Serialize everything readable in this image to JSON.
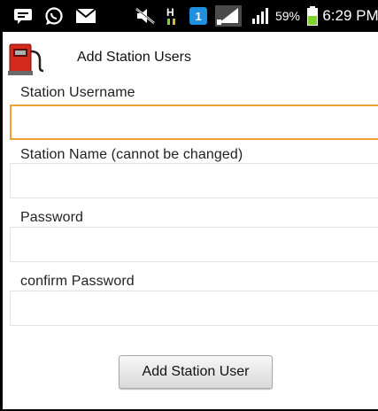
{
  "status_bar": {
    "icons": [
      "messenger-icon",
      "whatsapp-icon",
      "email-icon",
      "mute-icon",
      "data-transfer-icon",
      "notification-icon",
      "signal-icon",
      "signal-icon"
    ],
    "signal_indicator": "H",
    "notification_badge": "1",
    "battery_percent": "59%",
    "time": "6:29 PM"
  },
  "header": {
    "title": "Add Station Users",
    "app_icon": "fuel-pump-icon"
  },
  "form": {
    "username": {
      "label": "Station Username",
      "value": "",
      "placeholder": ""
    },
    "station_name": {
      "label": "Station Name (cannot be changed)",
      "value": "",
      "placeholder": ""
    },
    "password": {
      "label": "Password",
      "value": "",
      "placeholder": ""
    },
    "confirm_password": {
      "label": "confirm Password",
      "value": "",
      "placeholder": ""
    },
    "submit_label": "Add Station User"
  },
  "colors": {
    "focus_border": "#f0a035",
    "pump_red": "#d42a1e",
    "battery_green": "#7fd32a",
    "badge_blue": "#1f8fe0"
  }
}
